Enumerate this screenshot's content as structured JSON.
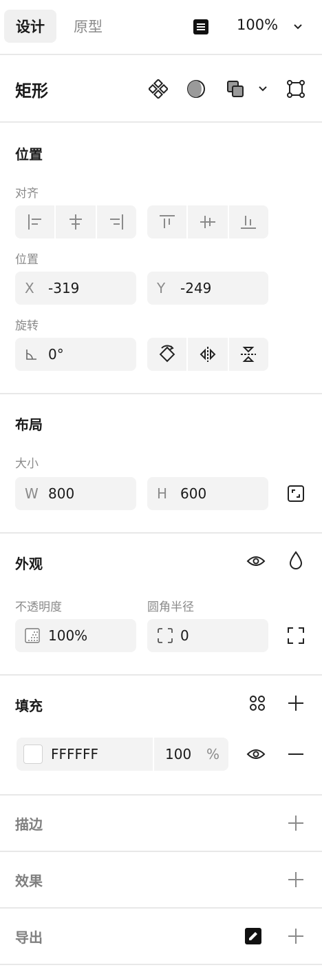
{
  "topbar": {
    "tabs": [
      {
        "label": "设计",
        "active": true
      },
      {
        "label": "原型",
        "active": false
      }
    ],
    "zoom": "100%"
  },
  "element": {
    "title": "矩形"
  },
  "position_section": {
    "title": "位置",
    "align_label": "对齐",
    "position_label": "位置",
    "x_prefix": "X",
    "x_value": "-319",
    "y_prefix": "Y",
    "y_value": "-249",
    "rotation_label": "旋转",
    "rotation_value": "0°"
  },
  "layout_section": {
    "title": "布局",
    "size_label": "大小",
    "w_prefix": "W",
    "w_value": "800",
    "h_prefix": "H",
    "h_value": "600"
  },
  "appearance_section": {
    "title": "外观",
    "opacity_label": "不透明度",
    "opacity_value": "100%",
    "radius_label": "圆角半径",
    "radius_value": "0"
  },
  "fill_section": {
    "title": "填充",
    "color_hex": "FFFFFF",
    "swatch_color": "#FFFFFF",
    "opacity": "100",
    "percent": "%"
  },
  "stroke_section": {
    "title": "描边"
  },
  "effects_section": {
    "title": "效果"
  },
  "export_section": {
    "title": "导出"
  }
}
